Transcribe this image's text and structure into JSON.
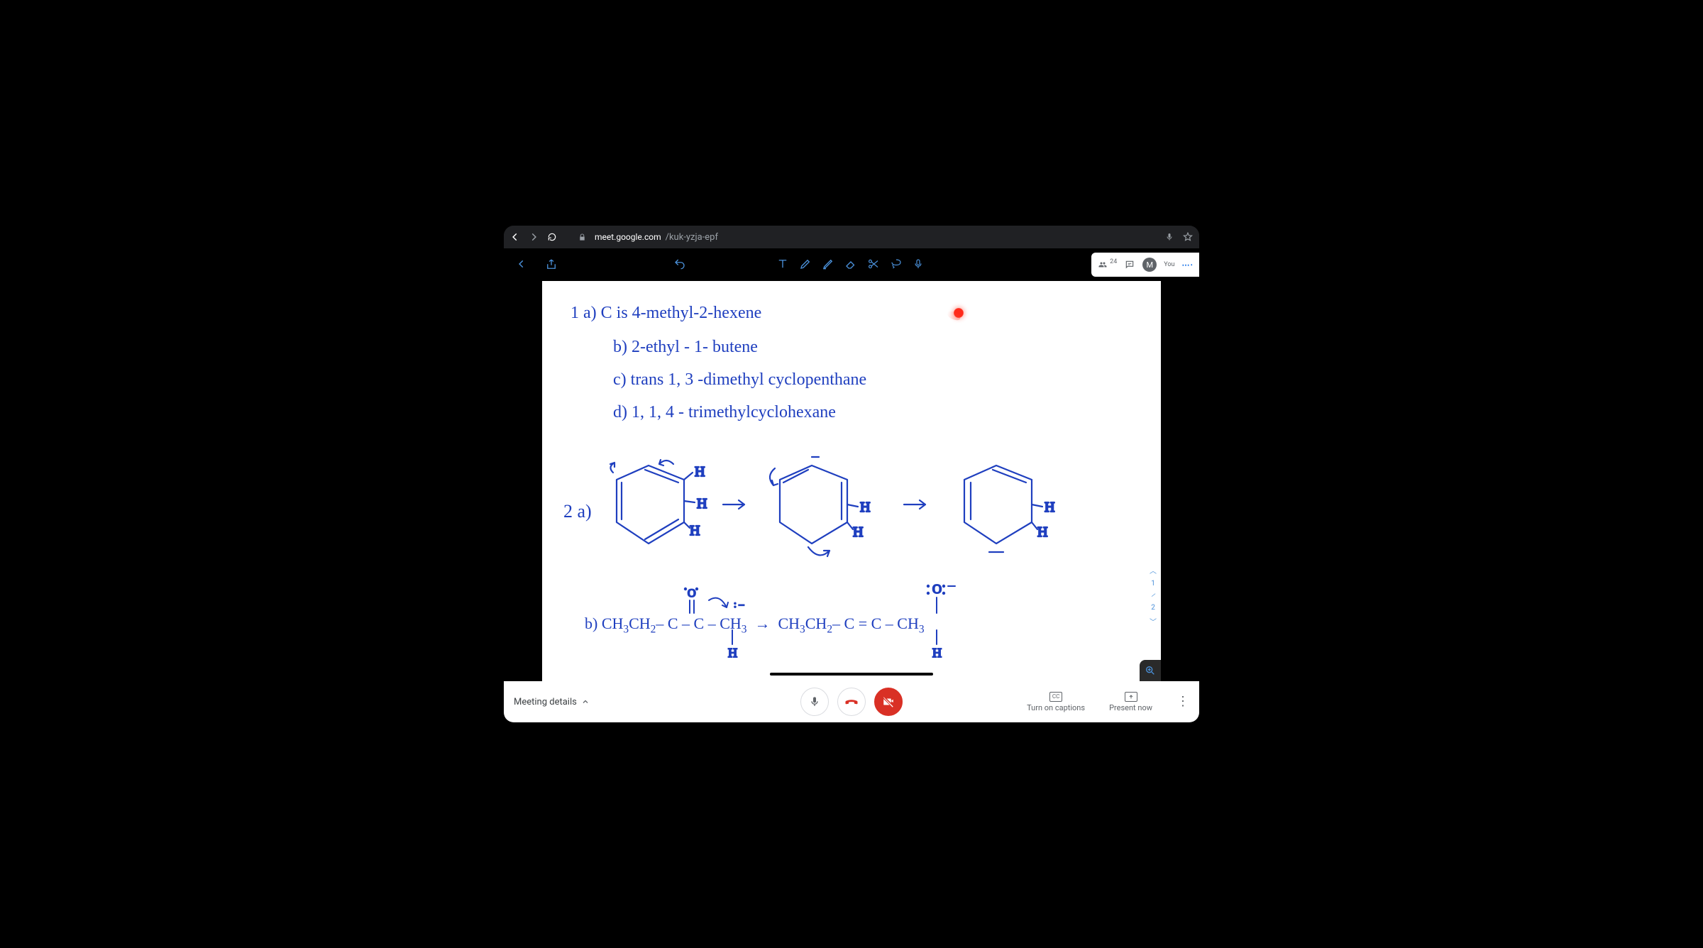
{
  "browser": {
    "url_host": "meet.google.com",
    "url_path": "/kuk-yzja-epf"
  },
  "participants": {
    "count": "24",
    "you_label": "You",
    "avatar_initial": "M"
  },
  "whiteboard": {
    "line1a": "1   a)  C  is  4-methyl-2-hexene",
    "line1b": "b) 2-ethyl - 1- butene",
    "line1c": "c) trans 1, 3 -dimethyl cyclopenthane",
    "line1d": "d)  1, 1, 4 - trimethylcyclohexane",
    "q2_label": "2 a)",
    "q2b_prefix": "b)  CH",
    "page_current": "1",
    "page_total": "2"
  },
  "bottom": {
    "meeting_details": "Meeting details",
    "captions": "Turn on captions",
    "present": "Present now"
  }
}
